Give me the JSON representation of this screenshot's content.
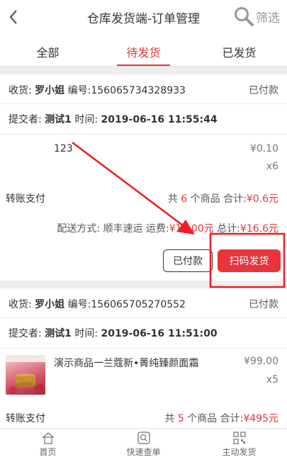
{
  "header": {
    "title": "仓库发货端-订单管理",
    "search_label": "筛选"
  },
  "tabs": [
    {
      "label": "全部"
    },
    {
      "label": "待发货",
      "active": true
    },
    {
      "label": "已发货"
    }
  ],
  "orders": [
    {
      "receiver_prefix": "收货:",
      "receiver_name": "罗小姐",
      "number_prefix": "编号:",
      "number": "156065734328933",
      "status": "已付款",
      "submitter_prefix": "提交者:",
      "submitter": "测试1",
      "time_prefix": "时间:",
      "time": "2019-06-16 11:55:44",
      "item": {
        "name": "123",
        "price": "¥0.10",
        "qty": "x6",
        "has_image": false
      },
      "payment": "转账支付",
      "total_prefix": "共",
      "count": "6",
      "count_suffix": "个商品 合计:",
      "subtotal": "¥0.6元",
      "delivery_prefix": "配送方式:",
      "delivery_method": "顺丰速运",
      "freight_prefix": "运费:",
      "freight": "¥16.00元",
      "grand_prefix": "总计:",
      "grand_total": "¥16.6元",
      "btn_paid": "已付款",
      "btn_ship": "扫码发货"
    },
    {
      "receiver_prefix": "收货:",
      "receiver_name": "罗小姐",
      "number_prefix": "编号:",
      "number": "156065705270552",
      "status": "已付款",
      "submitter_prefix": "提交者:",
      "submitter": "测试1",
      "time_prefix": "时间:",
      "time": "2019-06-16 11:51:00",
      "item": {
        "name": "演示商品一兰蔻新•菁纯臻颜面霜",
        "price": "¥99.00",
        "qty": "x5",
        "has_image": true
      },
      "payment": "转账支付",
      "total_prefix": "共",
      "count": "5",
      "count_suffix": "个商品 合计:",
      "subtotal": "¥495元"
    }
  ],
  "bottom_nav": [
    {
      "label": "首页",
      "icon": "home-icon"
    },
    {
      "label": "快速查单",
      "icon": "quick-search-icon"
    },
    {
      "label": "主动发货",
      "icon": "qr-code-icon"
    }
  ],
  "colors": {
    "accent": "#e8343b",
    "annotation": "#ee1c25"
  }
}
